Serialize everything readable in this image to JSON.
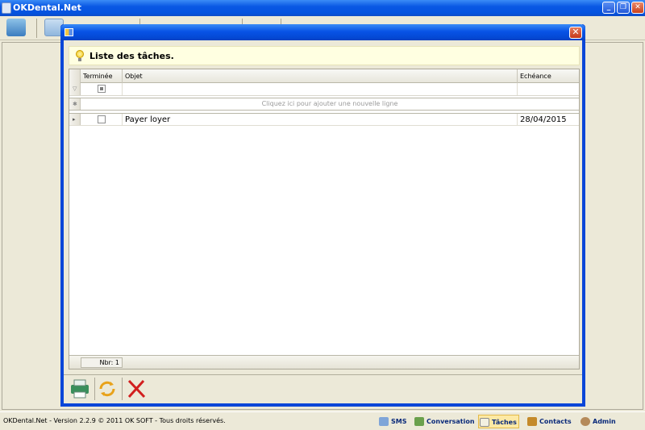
{
  "window": {
    "title": "OKDental.Net"
  },
  "dialog": {
    "info_text": "Liste des tâches.",
    "columns": [
      "Terminée",
      "Objet",
      "Echéance"
    ],
    "add_row_hint": "Cliquez ici pour ajouter une nouvelle ligne",
    "rows": [
      {
        "done": false,
        "subject": "Payer loyer",
        "due": "28/04/2015"
      }
    ],
    "count_label": "Nbr: 1"
  },
  "status": {
    "version": "OKDental.Net - Version 2.2.9 © 2011 OK SOFT - Tous droits réservés.",
    "buttons": [
      "SMS",
      "Conversation",
      "Tâches",
      "Contacts",
      "Admin"
    ],
    "active_button": "Tâches"
  },
  "colors": {
    "titlebar": "#0a58e4",
    "dialog_border": "#0a46d8",
    "close_red": "#c9411c",
    "info_bg": "#ffffe1",
    "active_tab": "#fde9a5"
  }
}
